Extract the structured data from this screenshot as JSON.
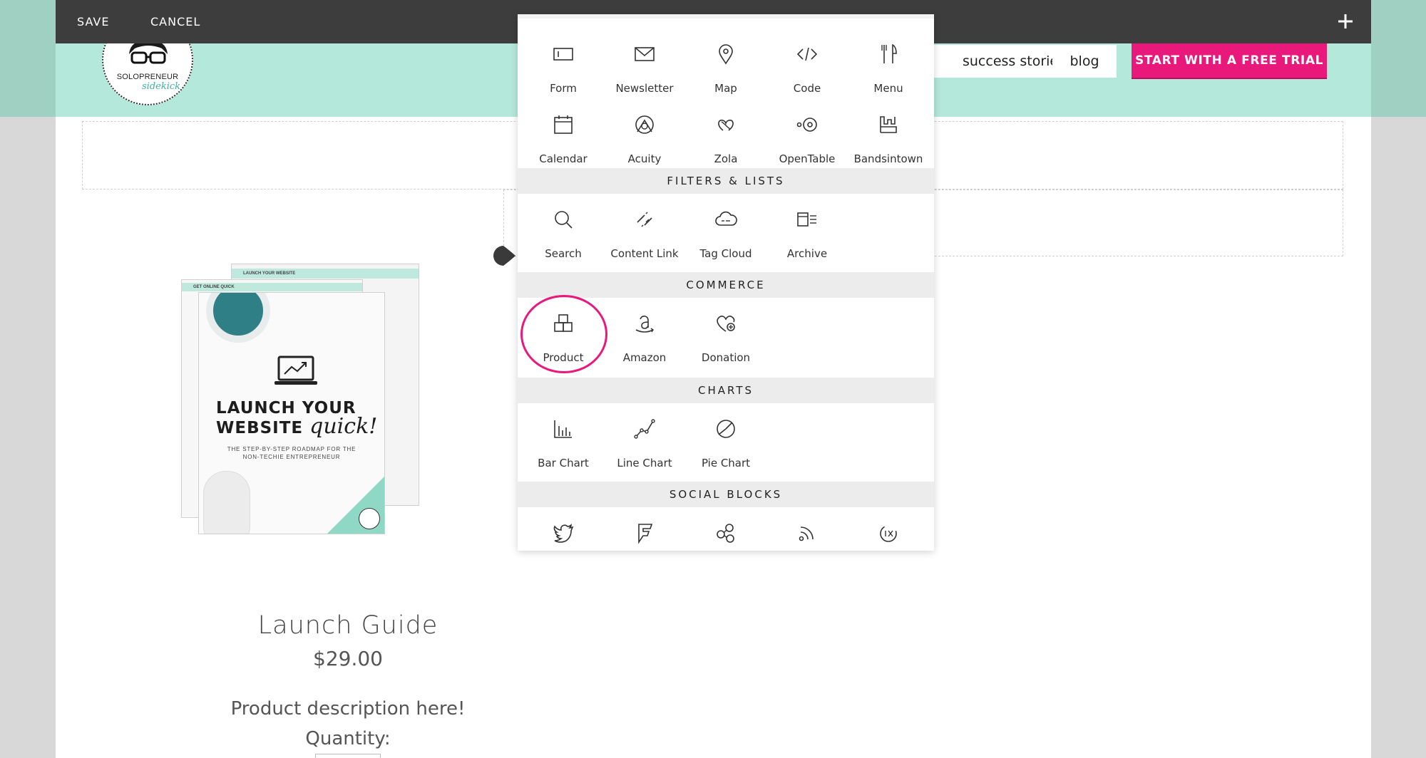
{
  "editor_toolbar": {
    "save_label": "SAVE",
    "cancel_label": "CANCEL",
    "add_icon": "plus-icon"
  },
  "site_header": {
    "logo": {
      "line1": "SOLOPRENEUR",
      "line2": "sidekick"
    },
    "nav": {
      "success_stories": "success stories",
      "blog": "blog"
    },
    "cta_label": "START WITH A FREE TRIAL"
  },
  "product": {
    "image": {
      "back_band": "LAUNCH YOUR WEBSITE",
      "mid_band": "GET ONLINE QUICK",
      "title_line1": "LAUNCH YOUR",
      "title_line2": "WEBSITE",
      "title_script": "quick!",
      "subtitle_line1": "THE STEP-BY-STEP ROADMAP FOR THE",
      "subtitle_line2": "NON-TECHIE ENTREPRENEUR"
    },
    "title": "Launch Guide",
    "price": "$29.00",
    "description": "Product description here!",
    "quantity_label": "Quantity:"
  },
  "block_picker": {
    "rows": [
      [
        {
          "label": "Form",
          "icon": "form-icon"
        },
        {
          "label": "Newsletter",
          "icon": "newsletter-icon"
        },
        {
          "label": "Map",
          "icon": "map-icon"
        },
        {
          "label": "Code",
          "icon": "code-icon"
        },
        {
          "label": "Menu",
          "icon": "menu-icon"
        }
      ],
      [
        {
          "label": "Calendar",
          "icon": "calendar-icon"
        },
        {
          "label": "Acuity",
          "icon": "acuity-icon"
        },
        {
          "label": "Zola",
          "icon": "zola-icon"
        },
        {
          "label": "OpenTable",
          "icon": "opentable-icon"
        },
        {
          "label": "Bandsintown",
          "icon": "bandsintown-icon"
        }
      ]
    ],
    "sections": [
      {
        "title": "FILTERS & LISTS",
        "items": [
          {
            "label": "Search",
            "icon": "search-icon"
          },
          {
            "label": "Content Link",
            "icon": "content-link-icon"
          },
          {
            "label": "Tag Cloud",
            "icon": "tag-cloud-icon"
          },
          {
            "label": "Archive",
            "icon": "archive-icon"
          }
        ]
      },
      {
        "title": "COMMERCE",
        "items": [
          {
            "label": "Product",
            "icon": "product-icon",
            "highlighted": true
          },
          {
            "label": "Amazon",
            "icon": "amazon-icon"
          },
          {
            "label": "Donation",
            "icon": "donation-icon"
          }
        ]
      },
      {
        "title": "CHARTS",
        "items": [
          {
            "label": "Bar Chart",
            "icon": "bar-chart-icon"
          },
          {
            "label": "Line Chart",
            "icon": "line-chart-icon"
          },
          {
            "label": "Pie Chart",
            "icon": "pie-chart-icon"
          }
        ]
      },
      {
        "title": "SOCIAL BLOCKS",
        "items": [
          {
            "label": "",
            "icon": "twitter-icon"
          },
          {
            "label": "",
            "icon": "foursquare-icon"
          },
          {
            "label": "",
            "icon": "flickr-icon"
          },
          {
            "label": "",
            "icon": "rss-icon"
          },
          {
            "label": "",
            "icon": "500px-icon"
          }
        ]
      }
    ]
  },
  "colors": {
    "accent_pink": "#e8197a",
    "header_mint": "#b4e8da",
    "toolbar_dark": "#3d3d3d"
  }
}
